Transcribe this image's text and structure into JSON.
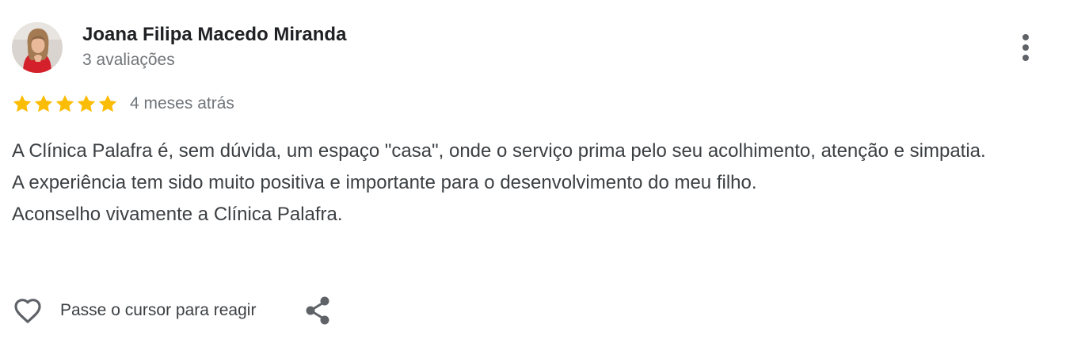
{
  "review": {
    "reviewer_name": "Joana Filipa Macedo Miranda",
    "review_count": "3 avaliações",
    "rating": 5,
    "rating_max": 5,
    "time_ago": "4 meses atrás",
    "text": {
      "line1": "A Clínica Palafra é, sem dúvida, um espaço \"casa\", onde o serviço prima pelo seu acolhimento, atenção e simpatia.",
      "line2": "A experiência tem sido muito positiva e importante para o desenvolvimento do meu filho.",
      "line3": "Aconselho vivamente a Clínica Palafra."
    }
  },
  "actions": {
    "like_label": "Passe o cursor para reagir"
  },
  "icons": {
    "star": "star-icon",
    "more": "more-vert-icon",
    "like": "heart-outline-icon",
    "share": "share-icon"
  },
  "colors": {
    "star": "#fbbc04",
    "name": "#202124",
    "secondary_text": "#70757a",
    "body_text": "#3c4043",
    "icon": "#5f6368"
  }
}
